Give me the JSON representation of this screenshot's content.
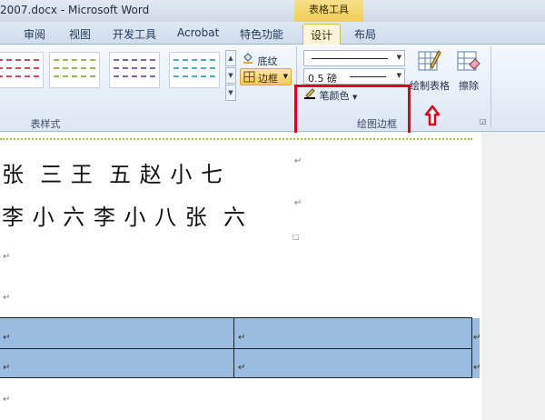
{
  "window": {
    "title": "2007.docx - Microsoft Word",
    "context_title": "表格工具"
  },
  "tabs": [
    {
      "label": "审阅"
    },
    {
      "label": "视图"
    },
    {
      "label": "开发工具"
    },
    {
      "label": "Acrobat"
    },
    {
      "label": "特色功能"
    },
    {
      "label": "设计"
    },
    {
      "label": "布局"
    }
  ],
  "active_tab": "设计",
  "ribbon": {
    "table_styles_label": "表样式",
    "shading_label": "底纹",
    "borders_label": "边框",
    "draw_borders_label": "绘图边框",
    "line_weight": "0.5 磅",
    "pen_color_label": "笔颜色",
    "draw_table_label": "绘制表格",
    "eraser_label": "擦除"
  },
  "style_colors": [
    "#d04c5a",
    "#8fbc56",
    "#8064a2",
    "#4bacc6"
  ],
  "accent_color": "#e3001b",
  "document": {
    "lines": [
      "张  三 王  五 赵 小 七",
      "李 小 六 李 小 八 张  六"
    ],
    "paragraph_mark": "↵",
    "cell_mark": "↵"
  }
}
